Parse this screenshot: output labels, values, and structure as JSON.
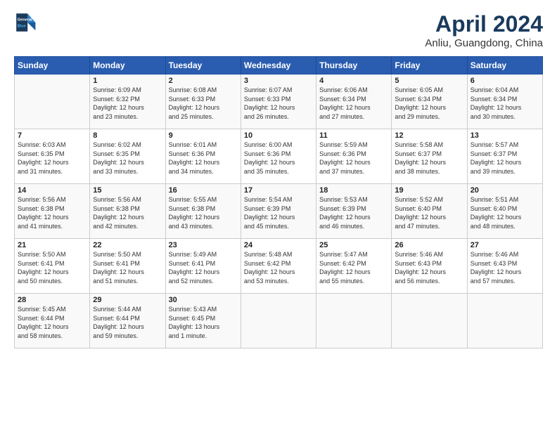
{
  "header": {
    "logo_line1": "General",
    "logo_line2": "Blue",
    "title": "April 2024",
    "subtitle": "Anliu, Guangdong, China"
  },
  "weekdays": [
    "Sunday",
    "Monday",
    "Tuesday",
    "Wednesday",
    "Thursday",
    "Friday",
    "Saturday"
  ],
  "weeks": [
    [
      {
        "day": "",
        "info": ""
      },
      {
        "day": "1",
        "info": "Sunrise: 6:09 AM\nSunset: 6:32 PM\nDaylight: 12 hours\nand 23 minutes."
      },
      {
        "day": "2",
        "info": "Sunrise: 6:08 AM\nSunset: 6:33 PM\nDaylight: 12 hours\nand 25 minutes."
      },
      {
        "day": "3",
        "info": "Sunrise: 6:07 AM\nSunset: 6:33 PM\nDaylight: 12 hours\nand 26 minutes."
      },
      {
        "day": "4",
        "info": "Sunrise: 6:06 AM\nSunset: 6:34 PM\nDaylight: 12 hours\nand 27 minutes."
      },
      {
        "day": "5",
        "info": "Sunrise: 6:05 AM\nSunset: 6:34 PM\nDaylight: 12 hours\nand 29 minutes."
      },
      {
        "day": "6",
        "info": "Sunrise: 6:04 AM\nSunset: 6:34 PM\nDaylight: 12 hours\nand 30 minutes."
      }
    ],
    [
      {
        "day": "7",
        "info": "Sunrise: 6:03 AM\nSunset: 6:35 PM\nDaylight: 12 hours\nand 31 minutes."
      },
      {
        "day": "8",
        "info": "Sunrise: 6:02 AM\nSunset: 6:35 PM\nDaylight: 12 hours\nand 33 minutes."
      },
      {
        "day": "9",
        "info": "Sunrise: 6:01 AM\nSunset: 6:36 PM\nDaylight: 12 hours\nand 34 minutes."
      },
      {
        "day": "10",
        "info": "Sunrise: 6:00 AM\nSunset: 6:36 PM\nDaylight: 12 hours\nand 35 minutes."
      },
      {
        "day": "11",
        "info": "Sunrise: 5:59 AM\nSunset: 6:36 PM\nDaylight: 12 hours\nand 37 minutes."
      },
      {
        "day": "12",
        "info": "Sunrise: 5:58 AM\nSunset: 6:37 PM\nDaylight: 12 hours\nand 38 minutes."
      },
      {
        "day": "13",
        "info": "Sunrise: 5:57 AM\nSunset: 6:37 PM\nDaylight: 12 hours\nand 39 minutes."
      }
    ],
    [
      {
        "day": "14",
        "info": "Sunrise: 5:56 AM\nSunset: 6:38 PM\nDaylight: 12 hours\nand 41 minutes."
      },
      {
        "day": "15",
        "info": "Sunrise: 5:56 AM\nSunset: 6:38 PM\nDaylight: 12 hours\nand 42 minutes."
      },
      {
        "day": "16",
        "info": "Sunrise: 5:55 AM\nSunset: 6:38 PM\nDaylight: 12 hours\nand 43 minutes."
      },
      {
        "day": "17",
        "info": "Sunrise: 5:54 AM\nSunset: 6:39 PM\nDaylight: 12 hours\nand 45 minutes."
      },
      {
        "day": "18",
        "info": "Sunrise: 5:53 AM\nSunset: 6:39 PM\nDaylight: 12 hours\nand 46 minutes."
      },
      {
        "day": "19",
        "info": "Sunrise: 5:52 AM\nSunset: 6:40 PM\nDaylight: 12 hours\nand 47 minutes."
      },
      {
        "day": "20",
        "info": "Sunrise: 5:51 AM\nSunset: 6:40 PM\nDaylight: 12 hours\nand 48 minutes."
      }
    ],
    [
      {
        "day": "21",
        "info": "Sunrise: 5:50 AM\nSunset: 6:41 PM\nDaylight: 12 hours\nand 50 minutes."
      },
      {
        "day": "22",
        "info": "Sunrise: 5:50 AM\nSunset: 6:41 PM\nDaylight: 12 hours\nand 51 minutes."
      },
      {
        "day": "23",
        "info": "Sunrise: 5:49 AM\nSunset: 6:41 PM\nDaylight: 12 hours\nand 52 minutes."
      },
      {
        "day": "24",
        "info": "Sunrise: 5:48 AM\nSunset: 6:42 PM\nDaylight: 12 hours\nand 53 minutes."
      },
      {
        "day": "25",
        "info": "Sunrise: 5:47 AM\nSunset: 6:42 PM\nDaylight: 12 hours\nand 55 minutes."
      },
      {
        "day": "26",
        "info": "Sunrise: 5:46 AM\nSunset: 6:43 PM\nDaylight: 12 hours\nand 56 minutes."
      },
      {
        "day": "27",
        "info": "Sunrise: 5:46 AM\nSunset: 6:43 PM\nDaylight: 12 hours\nand 57 minutes."
      }
    ],
    [
      {
        "day": "28",
        "info": "Sunrise: 5:45 AM\nSunset: 6:44 PM\nDaylight: 12 hours\nand 58 minutes."
      },
      {
        "day": "29",
        "info": "Sunrise: 5:44 AM\nSunset: 6:44 PM\nDaylight: 12 hours\nand 59 minutes."
      },
      {
        "day": "30",
        "info": "Sunrise: 5:43 AM\nSunset: 6:45 PM\nDaylight: 13 hours\nand 1 minute."
      },
      {
        "day": "",
        "info": ""
      },
      {
        "day": "",
        "info": ""
      },
      {
        "day": "",
        "info": ""
      },
      {
        "day": "",
        "info": ""
      }
    ]
  ]
}
